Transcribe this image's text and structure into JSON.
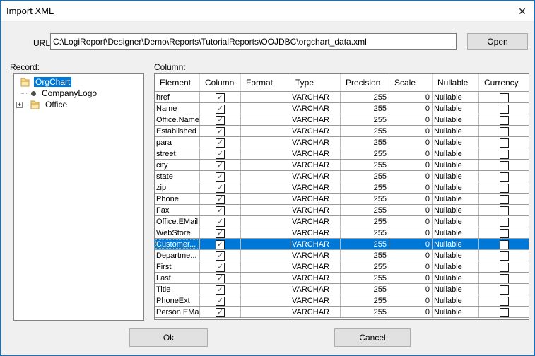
{
  "dialog": {
    "title": "Import XML",
    "close_glyph": "✕"
  },
  "url_section": {
    "label": "URL:",
    "value": "C:\\LogiReport\\Designer\\Demo\\Reports\\TutorialReports\\OOJDBC\\orgchart_data.xml",
    "open_button": "Open"
  },
  "record_section": {
    "label": "Record:",
    "items": [
      {
        "label": "OrgChart",
        "icon": "folder",
        "selected": true,
        "expander": "",
        "level": 0
      },
      {
        "label": "CompanyLogo",
        "icon": "bullet",
        "selected": false,
        "expander": "",
        "level": 1
      },
      {
        "label": "Office",
        "icon": "folder",
        "selected": false,
        "expander": "+",
        "level": 0
      }
    ]
  },
  "column_section": {
    "label": "Column:",
    "headers": [
      "Element",
      "Column",
      "Format",
      "Type",
      "Precision",
      "Scale",
      "Nullable",
      "Currency"
    ],
    "rows": [
      {
        "element": "href",
        "column_checked": true,
        "format": "",
        "type": "VARCHAR",
        "precision": "255",
        "scale": "0",
        "nullable": "Nullable",
        "currency_checked": false,
        "selected": false
      },
      {
        "element": "Name",
        "column_checked": true,
        "format": "",
        "type": "VARCHAR",
        "precision": "255",
        "scale": "0",
        "nullable": "Nullable",
        "currency_checked": false,
        "selected": false
      },
      {
        "element": "Office.Name",
        "column_checked": true,
        "format": "",
        "type": "VARCHAR",
        "precision": "255",
        "scale": "0",
        "nullable": "Nullable",
        "currency_checked": false,
        "selected": false
      },
      {
        "element": "Established",
        "column_checked": true,
        "format": "",
        "type": "VARCHAR",
        "precision": "255",
        "scale": "0",
        "nullable": "Nullable",
        "currency_checked": false,
        "selected": false
      },
      {
        "element": "para",
        "column_checked": true,
        "format": "",
        "type": "VARCHAR",
        "precision": "255",
        "scale": "0",
        "nullable": "Nullable",
        "currency_checked": false,
        "selected": false
      },
      {
        "element": "street",
        "column_checked": true,
        "format": "",
        "type": "VARCHAR",
        "precision": "255",
        "scale": "0",
        "nullable": "Nullable",
        "currency_checked": false,
        "selected": false
      },
      {
        "element": "city",
        "column_checked": true,
        "format": "",
        "type": "VARCHAR",
        "precision": "255",
        "scale": "0",
        "nullable": "Nullable",
        "currency_checked": false,
        "selected": false
      },
      {
        "element": "state",
        "column_checked": true,
        "format": "",
        "type": "VARCHAR",
        "precision": "255",
        "scale": "0",
        "nullable": "Nullable",
        "currency_checked": false,
        "selected": false
      },
      {
        "element": "zip",
        "column_checked": true,
        "format": "",
        "type": "VARCHAR",
        "precision": "255",
        "scale": "0",
        "nullable": "Nullable",
        "currency_checked": false,
        "selected": false
      },
      {
        "element": "Phone",
        "column_checked": true,
        "format": "",
        "type": "VARCHAR",
        "precision": "255",
        "scale": "0",
        "nullable": "Nullable",
        "currency_checked": false,
        "selected": false
      },
      {
        "element": "Fax",
        "column_checked": true,
        "format": "",
        "type": "VARCHAR",
        "precision": "255",
        "scale": "0",
        "nullable": "Nullable",
        "currency_checked": false,
        "selected": false
      },
      {
        "element": "Office.EMail",
        "column_checked": true,
        "format": "",
        "type": "VARCHAR",
        "precision": "255",
        "scale": "0",
        "nullable": "Nullable",
        "currency_checked": false,
        "selected": false
      },
      {
        "element": "WebStore",
        "column_checked": true,
        "format": "",
        "type": "VARCHAR",
        "precision": "255",
        "scale": "0",
        "nullable": "Nullable",
        "currency_checked": false,
        "selected": false
      },
      {
        "element": "Customer...",
        "column_checked": true,
        "format": "",
        "type": "VARCHAR",
        "precision": "255",
        "scale": "0",
        "nullable": "Nullable",
        "currency_checked": false,
        "selected": true
      },
      {
        "element": "Departme...",
        "column_checked": true,
        "format": "",
        "type": "VARCHAR",
        "precision": "255",
        "scale": "0",
        "nullable": "Nullable",
        "currency_checked": false,
        "selected": false
      },
      {
        "element": "First",
        "column_checked": true,
        "format": "",
        "type": "VARCHAR",
        "precision": "255",
        "scale": "0",
        "nullable": "Nullable",
        "currency_checked": false,
        "selected": false
      },
      {
        "element": "Last",
        "column_checked": true,
        "format": "",
        "type": "VARCHAR",
        "precision": "255",
        "scale": "0",
        "nullable": "Nullable",
        "currency_checked": false,
        "selected": false
      },
      {
        "element": "Title",
        "column_checked": true,
        "format": "",
        "type": "VARCHAR",
        "precision": "255",
        "scale": "0",
        "nullable": "Nullable",
        "currency_checked": false,
        "selected": false
      },
      {
        "element": "PhoneExt",
        "column_checked": true,
        "format": "",
        "type": "VARCHAR",
        "precision": "255",
        "scale": "0",
        "nullable": "Nullable",
        "currency_checked": false,
        "selected": false
      },
      {
        "element": "Person.EMail",
        "column_checked": true,
        "format": "",
        "type": "VARCHAR",
        "precision": "255",
        "scale": "0",
        "nullable": "Nullable",
        "currency_checked": false,
        "selected": false
      }
    ]
  },
  "footer": {
    "ok_label": "Ok",
    "cancel_label": "Cancel"
  },
  "colors": {
    "selection": "#0078d7",
    "dialog_border": "#0078d7",
    "button_face": "#e1e1e1",
    "folder_fill": "#fbd77f",
    "folder_edge": "#c79c3f"
  }
}
